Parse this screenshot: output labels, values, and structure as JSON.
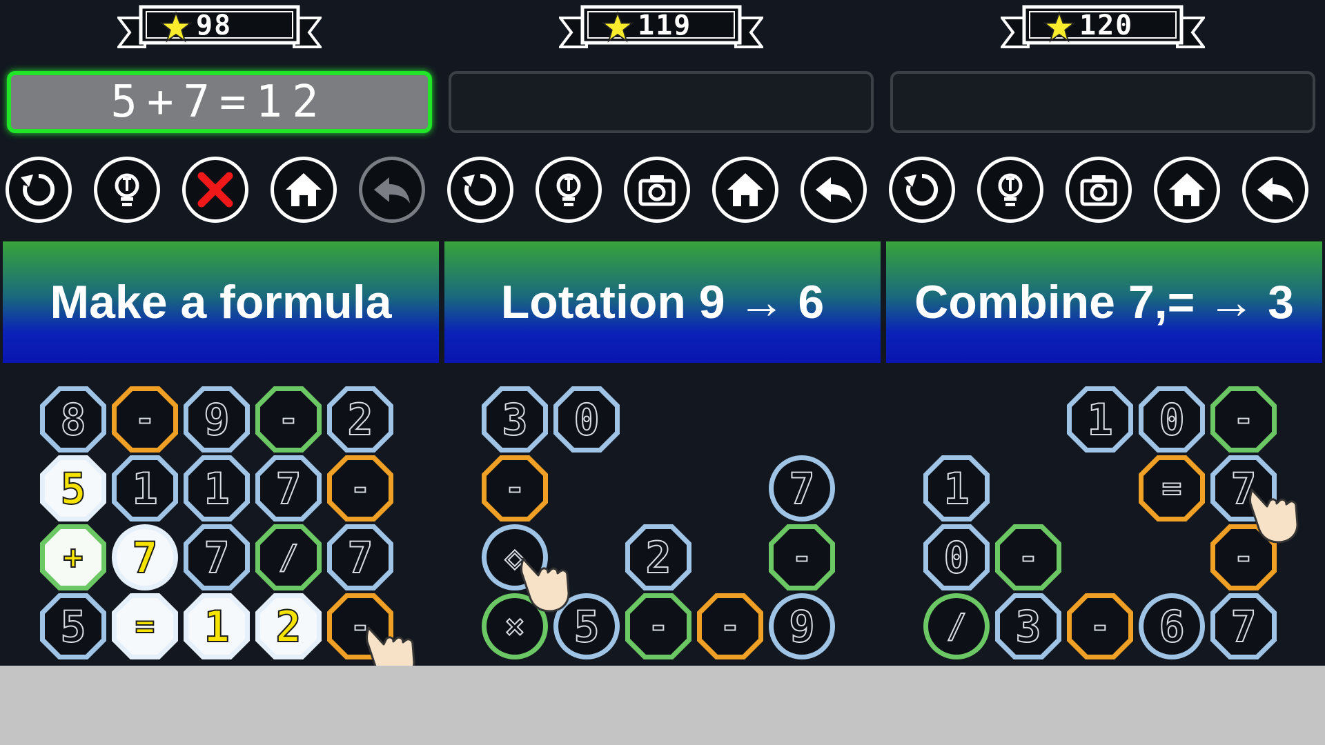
{
  "panels": [
    {
      "score": "98",
      "formula": "5+7=12",
      "formula_active": true,
      "banner": "Make a formula",
      "buttons": [
        {
          "name": "restart-button",
          "icon": "restart-icon",
          "state": "enabled"
        },
        {
          "name": "hint-button",
          "icon": "lightbulb-icon",
          "state": "enabled"
        },
        {
          "name": "close-button",
          "icon": "red-x-icon",
          "state": "enabled"
        },
        {
          "name": "home-button",
          "icon": "home-icon",
          "state": "enabled"
        },
        {
          "name": "undo-button",
          "icon": "undo-arrow-icon",
          "state": "disabled"
        }
      ],
      "tiles": [
        {
          "r": 0,
          "c": 0,
          "g": "8",
          "k": "oct",
          "col": "blue"
        },
        {
          "r": 0,
          "c": 1,
          "g": "-",
          "k": "oct",
          "col": "orange"
        },
        {
          "r": 0,
          "c": 2,
          "g": "9",
          "k": "oct",
          "col": "blue"
        },
        {
          "r": 0,
          "c": 3,
          "g": "-",
          "k": "oct",
          "col": "green"
        },
        {
          "r": 0,
          "c": 4,
          "g": "2",
          "k": "oct",
          "col": "blue"
        },
        {
          "r": 1,
          "c": 0,
          "g": "5",
          "k": "oct",
          "col": "lit"
        },
        {
          "r": 1,
          "c": 1,
          "g": "1",
          "k": "oct",
          "col": "blue"
        },
        {
          "r": 1,
          "c": 2,
          "g": "1",
          "k": "oct",
          "col": "blue"
        },
        {
          "r": 1,
          "c": 3,
          "g": "7",
          "k": "oct",
          "col": "blue"
        },
        {
          "r": 1,
          "c": 4,
          "g": "-",
          "k": "oct",
          "col": "orange"
        },
        {
          "r": 2,
          "c": 0,
          "g": "+",
          "k": "oct",
          "col": "lit-green"
        },
        {
          "r": 2,
          "c": 1,
          "g": "7",
          "k": "circ",
          "col": "lit"
        },
        {
          "r": 2,
          "c": 2,
          "g": "7",
          "k": "oct",
          "col": "blue"
        },
        {
          "r": 2,
          "c": 3,
          "g": "/",
          "k": "oct",
          "col": "green"
        },
        {
          "r": 2,
          "c": 4,
          "g": "7",
          "k": "oct",
          "col": "blue"
        },
        {
          "r": 3,
          "c": 0,
          "g": "5",
          "k": "oct",
          "col": "blue"
        },
        {
          "r": 3,
          "c": 1,
          "g": "=",
          "k": "oct",
          "col": "lit"
        },
        {
          "r": 3,
          "c": 2,
          "g": "1",
          "k": "oct",
          "col": "lit"
        },
        {
          "r": 3,
          "c": 3,
          "g": "2",
          "k": "oct",
          "col": "lit"
        },
        {
          "r": 3,
          "c": 4,
          "g": "-",
          "k": "oct",
          "col": "orange"
        }
      ],
      "hand": {
        "r": 3,
        "c": 4
      }
    },
    {
      "score": "119",
      "formula": "",
      "formula_active": false,
      "banner": "Lotation 9 → 6",
      "buttons": [
        {
          "name": "restart-button",
          "icon": "restart-icon",
          "state": "enabled"
        },
        {
          "name": "hint-button",
          "icon": "lightbulb-icon",
          "state": "enabled"
        },
        {
          "name": "camera-button",
          "icon": "camera-icon",
          "state": "enabled"
        },
        {
          "name": "home-button",
          "icon": "home-icon",
          "state": "enabled"
        },
        {
          "name": "undo-button",
          "icon": "undo-arrow-icon",
          "state": "enabled"
        }
      ],
      "tiles": [
        {
          "r": 0,
          "c": 0,
          "g": "3",
          "k": "oct",
          "col": "blue"
        },
        {
          "r": 0,
          "c": 1,
          "g": "0",
          "k": "oct",
          "col": "blue"
        },
        {
          "r": 1,
          "c": 0,
          "g": "-",
          "k": "oct",
          "col": "orange"
        },
        {
          "r": 1,
          "c": 4,
          "g": "7",
          "k": "circ",
          "col": "blue"
        },
        {
          "r": 2,
          "c": 0,
          "g": "◇",
          "k": "circ",
          "col": "blue"
        },
        {
          "r": 2,
          "c": 2,
          "g": "2",
          "k": "oct",
          "col": "blue"
        },
        {
          "r": 2,
          "c": 4,
          "g": "-",
          "k": "oct",
          "col": "green"
        },
        {
          "r": 3,
          "c": 0,
          "g": "×",
          "k": "circ",
          "col": "green"
        },
        {
          "r": 3,
          "c": 1,
          "g": "5",
          "k": "circ",
          "col": "blue"
        },
        {
          "r": 3,
          "c": 2,
          "g": "-",
          "k": "oct",
          "col": "green"
        },
        {
          "r": 3,
          "c": 3,
          "g": "-",
          "k": "oct",
          "col": "orange"
        },
        {
          "r": 3,
          "c": 4,
          "g": "9",
          "k": "circ",
          "col": "blue"
        }
      ],
      "hand": {
        "r": 2,
        "c": 0
      }
    },
    {
      "score": "120",
      "formula": "",
      "formula_active": false,
      "banner": "Combine 7,= → 3",
      "buttons": [
        {
          "name": "restart-button",
          "icon": "restart-icon",
          "state": "enabled"
        },
        {
          "name": "hint-button",
          "icon": "lightbulb-icon",
          "state": "enabled"
        },
        {
          "name": "camera-button",
          "icon": "camera-icon",
          "state": "enabled"
        },
        {
          "name": "home-button",
          "icon": "home-icon",
          "state": "enabled"
        },
        {
          "name": "undo-button",
          "icon": "undo-arrow-icon",
          "state": "enabled"
        }
      ],
      "tiles": [
        {
          "r": 0,
          "c": 2,
          "g": "1",
          "k": "oct",
          "col": "blue"
        },
        {
          "r": 0,
          "c": 3,
          "g": "0",
          "k": "oct",
          "col": "blue"
        },
        {
          "r": 0,
          "c": 4,
          "g": "-",
          "k": "oct",
          "col": "green"
        },
        {
          "r": 1,
          "c": 0,
          "g": "1",
          "k": "oct",
          "col": "blue"
        },
        {
          "r": 1,
          "c": 3,
          "g": "=",
          "k": "oct",
          "col": "orange"
        },
        {
          "r": 1,
          "c": 4,
          "g": "7",
          "k": "oct",
          "col": "blue"
        },
        {
          "r": 2,
          "c": 0,
          "g": "0",
          "k": "oct",
          "col": "blue"
        },
        {
          "r": 2,
          "c": 1,
          "g": "-",
          "k": "oct",
          "col": "green"
        },
        {
          "r": 2,
          "c": 4,
          "g": "-",
          "k": "oct",
          "col": "orange"
        },
        {
          "r": 3,
          "c": 0,
          "g": "/",
          "k": "circ",
          "col": "green"
        },
        {
          "r": 3,
          "c": 1,
          "g": "3",
          "k": "oct",
          "col": "blue"
        },
        {
          "r": 3,
          "c": 2,
          "g": "-",
          "k": "oct",
          "col": "orange"
        },
        {
          "r": 3,
          "c": 3,
          "g": "6",
          "k": "circ",
          "col": "blue"
        },
        {
          "r": 3,
          "c": 4,
          "g": "7",
          "k": "oct",
          "col": "blue"
        }
      ],
      "hand": {
        "r": 1,
        "c": 4
      }
    }
  ],
  "colors": {
    "tile_blue": "#9fc4e6",
    "tile_orange": "#f0a024",
    "tile_green": "#6cc864",
    "active_border": "#22e52a",
    "lit_digit": "#f6e400"
  }
}
